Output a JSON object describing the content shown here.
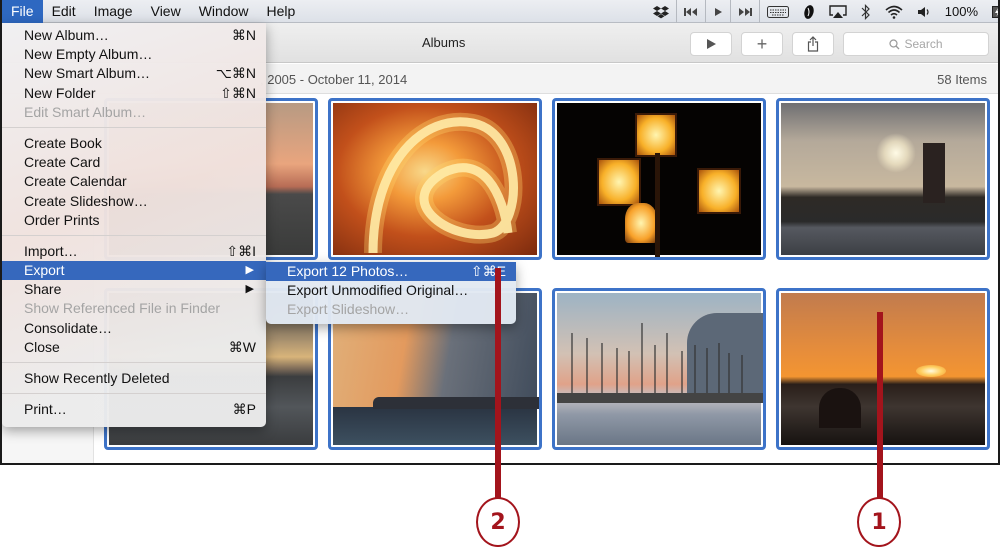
{
  "menubar": {
    "items": [
      "File",
      "Edit",
      "Image",
      "View",
      "Window",
      "Help"
    ],
    "active": "File",
    "status": {
      "icons": [
        "dropbox-icon",
        "rewind-icon",
        "play-icon",
        "fast-forward-icon",
        "keyboard-icon",
        "evernote-icon",
        "airplay-icon",
        "bluetooth-icon",
        "wifi-icon",
        "volume-icon",
        "battery-icon"
      ],
      "battery": "100%"
    }
  },
  "toolbar": {
    "title": "Albums",
    "play_icon": "▶",
    "add_icon": "+",
    "share_icon": "⇪",
    "search_placeholder": "Search"
  },
  "infobar": {
    "date_range": ", 2005 - October 11, 2014",
    "item_count": "58 Items"
  },
  "file_menu": {
    "groups": [
      [
        {
          "label": "New Album…",
          "shortcut": "⌘N",
          "disabled": false
        },
        {
          "label": "New Empty Album…",
          "shortcut": "",
          "disabled": false
        },
        {
          "label": "New Smart Album…",
          "shortcut": "⌥⌘N",
          "disabled": false
        },
        {
          "label": "New Folder",
          "shortcut": "⇧⌘N",
          "disabled": false
        },
        {
          "label": "Edit Smart Album…",
          "shortcut": "",
          "disabled": true
        }
      ],
      [
        {
          "label": "Create Book",
          "shortcut": "",
          "disabled": false
        },
        {
          "label": "Create Card",
          "shortcut": "",
          "disabled": false
        },
        {
          "label": "Create Calendar",
          "shortcut": "",
          "disabled": false
        },
        {
          "label": "Create Slideshow…",
          "shortcut": "",
          "disabled": false
        },
        {
          "label": "Order Prints",
          "shortcut": "",
          "disabled": false
        }
      ],
      [
        {
          "label": "Import…",
          "shortcut": "⇧⌘I",
          "disabled": false
        },
        {
          "label": "Export",
          "shortcut": "▶",
          "disabled": false,
          "highlighted": true
        },
        {
          "label": "Share",
          "shortcut": "▶",
          "disabled": false
        },
        {
          "label": "Show Referenced File in Finder",
          "shortcut": "",
          "disabled": true
        },
        {
          "label": "Consolidate…",
          "shortcut": "",
          "disabled": false
        },
        {
          "label": "Close",
          "shortcut": "⌘W",
          "disabled": false
        }
      ],
      [
        {
          "label": "Show Recently Deleted",
          "shortcut": "",
          "disabled": false
        }
      ],
      [
        {
          "label": "Print…",
          "shortcut": "⌘P",
          "disabled": false
        }
      ]
    ]
  },
  "export_submenu": {
    "items": [
      {
        "label": "Export 12 Photos…",
        "shortcut": "⇧⌘E",
        "disabled": false,
        "highlighted": true
      },
      {
        "label": "Export Unmodified Original…",
        "shortcut": "",
        "disabled": false
      },
      {
        "label": "Export Slideshow…",
        "shortcut": "",
        "disabled": true
      }
    ]
  },
  "photos": [
    {
      "name": "sunset-coast",
      "selected": true
    },
    {
      "name": "fire-spinning",
      "selected": true
    },
    {
      "name": "street-lamps",
      "selected": true
    },
    {
      "name": "lighthouse-sunset",
      "selected": true
    },
    {
      "name": "sunset-sea",
      "selected": true
    },
    {
      "name": "sun-rays-clouds",
      "selected": true
    },
    {
      "name": "harbor-sailboats",
      "selected": true
    },
    {
      "name": "orange-sunset-dome",
      "selected": true
    }
  ],
  "callouts": [
    {
      "number": "1"
    },
    {
      "number": "2"
    }
  ],
  "accent_color": "#3668bd",
  "callout_color": "#a3141c"
}
